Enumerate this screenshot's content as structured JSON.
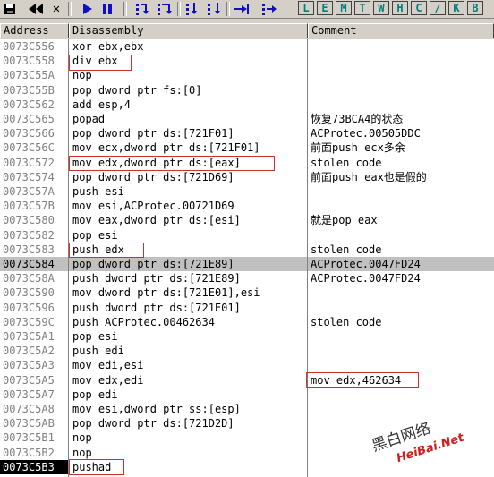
{
  "toolbar": {
    "icons": [
      "save-icon",
      "rewind-icon",
      "close-icon",
      "play-icon",
      "pause-icon",
      "step-into-icon",
      "step-over-icon",
      "trace-into-icon",
      "trace-over-icon",
      "execute-till-return-icon",
      "goto-icon"
    ],
    "letters": [
      "L",
      "E",
      "M",
      "T",
      "W",
      "H",
      "C",
      "/",
      "K",
      "B"
    ]
  },
  "columns": {
    "address": "Address",
    "disassembly": "Disassembly",
    "comment": "Comment"
  },
  "rows": [
    {
      "addr": "0073C556",
      "dis": "xor ebx,ebx",
      "com": ""
    },
    {
      "addr": "0073C558",
      "dis": "div ebx",
      "com": ""
    },
    {
      "addr": "0073C55A",
      "dis": "nop",
      "com": ""
    },
    {
      "addr": "0073C55B",
      "dis": "pop dword ptr fs:[0]",
      "com": ""
    },
    {
      "addr": "0073C562",
      "dis": "add esp,4",
      "com": ""
    },
    {
      "addr": "0073C565",
      "dis": "popad",
      "com": "恢复73BCA4的状态"
    },
    {
      "addr": "0073C566",
      "dis": "pop dword ptr ds:[721F01]",
      "com": "ACProtec.00505DDC"
    },
    {
      "addr": "0073C56C",
      "dis": "mov ecx,dword ptr ds:[721F01]",
      "com": "前面push ecx多余"
    },
    {
      "addr": "0073C572",
      "dis": "mov edx,dword ptr ds:[eax]",
      "com": "stolen code"
    },
    {
      "addr": "0073C574",
      "dis": "pop dword ptr ds:[721D69]",
      "com": "前面push eax也是假的"
    },
    {
      "addr": "0073C57A",
      "dis": "push esi",
      "com": ""
    },
    {
      "addr": "0073C57B",
      "dis": "mov esi,ACProtec.00721D69",
      "com": ""
    },
    {
      "addr": "0073C580",
      "dis": "mov eax,dword ptr ds:[esi]",
      "com": "就是pop eax"
    },
    {
      "addr": "0073C582",
      "dis": "pop esi",
      "com": ""
    },
    {
      "addr": "0073C583",
      "dis": "push edx",
      "com": "stolen code"
    },
    {
      "addr": "0073C584",
      "dis": "pop dword ptr ds:[721E89]",
      "com": "ACProtec.0047FD24"
    },
    {
      "addr": "0073C58A",
      "dis": "push dword ptr ds:[721E89]",
      "com": "ACProtec.0047FD24"
    },
    {
      "addr": "0073C590",
      "dis": "mov dword ptr ds:[721E01],esi",
      "com": ""
    },
    {
      "addr": "0073C596",
      "dis": "push dword ptr ds:[721E01]",
      "com": ""
    },
    {
      "addr": "0073C59C",
      "dis": "push ACProtec.00462634",
      "com": "stolen code"
    },
    {
      "addr": "0073C5A1",
      "dis": "pop esi",
      "com": ""
    },
    {
      "addr": "0073C5A2",
      "dis": "push edi",
      "com": ""
    },
    {
      "addr": "0073C5A3",
      "dis": "mov edi,esi",
      "com": ""
    },
    {
      "addr": "0073C5A5",
      "dis": "mov edx,edi",
      "com": "mov edx,462634"
    },
    {
      "addr": "0073C5A7",
      "dis": "pop edi",
      "com": ""
    },
    {
      "addr": "0073C5A8",
      "dis": "mov esi,dword ptr ss:[esp]",
      "com": ""
    },
    {
      "addr": "0073C5AB",
      "dis": "pop dword ptr ds:[721D2D]",
      "com": ""
    },
    {
      "addr": "0073C5B1",
      "dis": "nop",
      "com": ""
    },
    {
      "addr": "0073C5B2",
      "dis": "nop",
      "com": ""
    },
    {
      "addr": "0073C5B3",
      "dis": "pushad",
      "com": ""
    }
  ],
  "selected_address": "0073C584",
  "highlight_color": "#d03030",
  "watermark": {
    "line1": "黑白网络",
    "line2": "HeiBai.Net"
  }
}
